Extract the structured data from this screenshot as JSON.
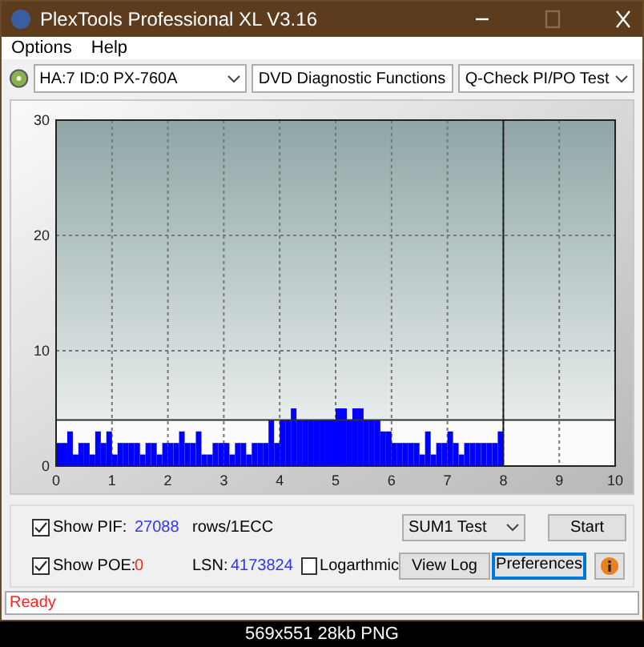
{
  "window": {
    "title": "PlexTools Professional XL V3.16"
  },
  "menu": [
    "Options",
    "Help"
  ],
  "toolbar": {
    "drive": "HA:7 ID:0  PX-760A",
    "function": "DVD Diagnostic Functions",
    "test": "Q-Check PI/PO Test"
  },
  "chart": {
    "chart_data": {
      "type": "bar",
      "x": [
        0.05,
        0.15,
        0.25,
        0.35,
        0.45,
        0.55,
        0.65,
        0.75,
        0.85,
        0.95,
        1.05,
        1.15,
        1.25,
        1.35,
        1.45,
        1.55,
        1.65,
        1.75,
        1.85,
        1.95,
        2.05,
        2.15,
        2.25,
        2.35,
        2.45,
        2.55,
        2.65,
        2.75,
        2.85,
        2.95,
        3.05,
        3.15,
        3.25,
        3.35,
        3.45,
        3.55,
        3.65,
        3.75,
        3.85,
        3.95,
        4.05,
        4.15,
        4.25,
        4.35,
        4.45,
        4.55,
        4.65,
        4.75,
        4.85,
        4.95,
        5.05,
        5.15,
        5.25,
        5.35,
        5.45,
        5.55,
        5.65,
        5.75,
        5.85,
        5.95,
        6.05,
        6.15,
        6.25,
        6.35,
        6.45,
        6.55,
        6.65,
        6.75,
        6.85,
        6.95,
        7.05,
        7.15,
        7.25,
        7.35,
        7.45,
        7.55,
        7.65,
        7.75,
        7.85,
        7.95
      ],
      "series": [
        {
          "color": "#0000ff",
          "values": [
            2,
            2,
            3,
            1,
            2,
            2,
            1,
            3,
            2,
            3,
            1,
            2,
            2,
            2,
            2,
            1,
            2,
            2,
            1,
            2,
            2,
            2,
            3,
            2,
            2,
            3,
            1,
            1,
            2,
            2,
            2,
            1,
            2,
            2,
            1,
            2,
            2,
            2,
            4,
            2,
            4,
            4,
            5,
            4,
            4,
            4,
            4,
            4,
            4,
            4,
            5,
            5,
            4,
            5,
            5,
            4,
            4,
            4,
            3,
            3,
            2,
            2,
            2,
            2,
            2,
            1,
            3,
            1,
            2,
            2,
            3,
            2,
            1,
            2,
            2,
            2,
            2,
            2,
            2,
            3
          ]
        }
      ],
      "xlim": [
        0,
        10
      ],
      "ylim": [
        0,
        30
      ],
      "xticks": [
        0,
        1,
        2,
        3,
        4,
        5,
        6,
        7,
        8,
        9,
        10
      ],
      "yticks": [
        0,
        10,
        20,
        30
      ],
      "grid": true,
      "ref_lines": [
        {
          "axis": "y",
          "value": 4
        },
        {
          "axis": "x",
          "value": 8
        }
      ],
      "bands": [
        {
          "axis": "y",
          "from": 0,
          "to": 4,
          "color": "#fbfbfb"
        }
      ]
    }
  },
  "controls": {
    "show_pif": {
      "label": "Show PIF:",
      "checked": true,
      "value": "27088",
      "unit": "rows/1ECC"
    },
    "show_poe": {
      "label": "Show POE:",
      "checked": true,
      "value": "0"
    },
    "lsn": {
      "label": "LSN:",
      "value": "4173824"
    },
    "logarithmic": {
      "label": "Logarthmic",
      "checked": false
    },
    "test_select": "SUM1 Test",
    "buttons": [
      {
        "label": "Start",
        "focused": false
      },
      {
        "label": "View Log",
        "focused": false
      },
      {
        "label": "Preferences",
        "focused": true
      }
    ]
  },
  "status_bar": "Ready",
  "caption": "569x551 28kb PNG"
}
